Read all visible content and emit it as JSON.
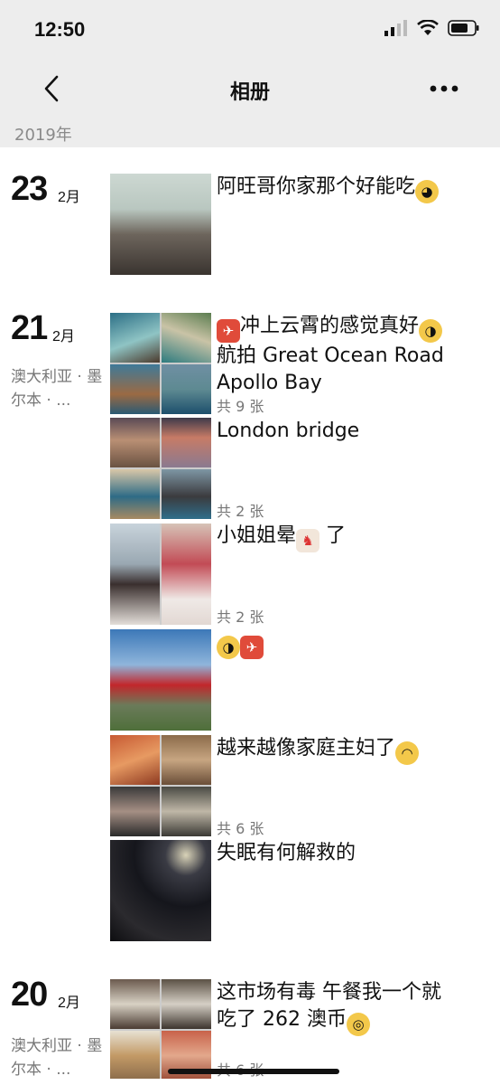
{
  "status": {
    "time": "12:50"
  },
  "nav": {
    "title": "相册"
  },
  "year": "2019年",
  "entries": [
    {
      "day": "23",
      "month": "2月",
      "location": "",
      "caption": "阿旺哥你家那个好能吃",
      "count": ""
    },
    {
      "day": "21",
      "month": "2月",
      "location": "澳大利亚 · 墨尔本 · ...",
      "posts": [
        {
          "caption_line1": "冲上云霄的感觉真好",
          "caption_line2": "航拍 Great Ocean Road",
          "caption_line3": "Apollo Bay",
          "count": "共 9 张"
        },
        {
          "caption": "London bridge",
          "count": "共 2 张"
        },
        {
          "caption": "小姐姐晕",
          "caption_tail": "了",
          "count": "共 2 张"
        },
        {
          "caption": "",
          "count": ""
        },
        {
          "caption": "越来越像家庭主妇了",
          "count": "共 6 张"
        },
        {
          "caption": "失眠有何解救的",
          "count": ""
        }
      ]
    },
    {
      "day": "20",
      "month": "2月",
      "location": "澳大利亚 · 墨尔本 · ...",
      "caption_line1": "这市场有毒  午餐我一个就",
      "caption_line2": "吃了 262 澳币",
      "count": "共 6 张"
    }
  ],
  "icons": {
    "back": "chevron-left-icon",
    "more": "more-dots-icon",
    "signal": "signal-icon",
    "wifi": "wifi-icon",
    "battery": "battery-icon"
  }
}
